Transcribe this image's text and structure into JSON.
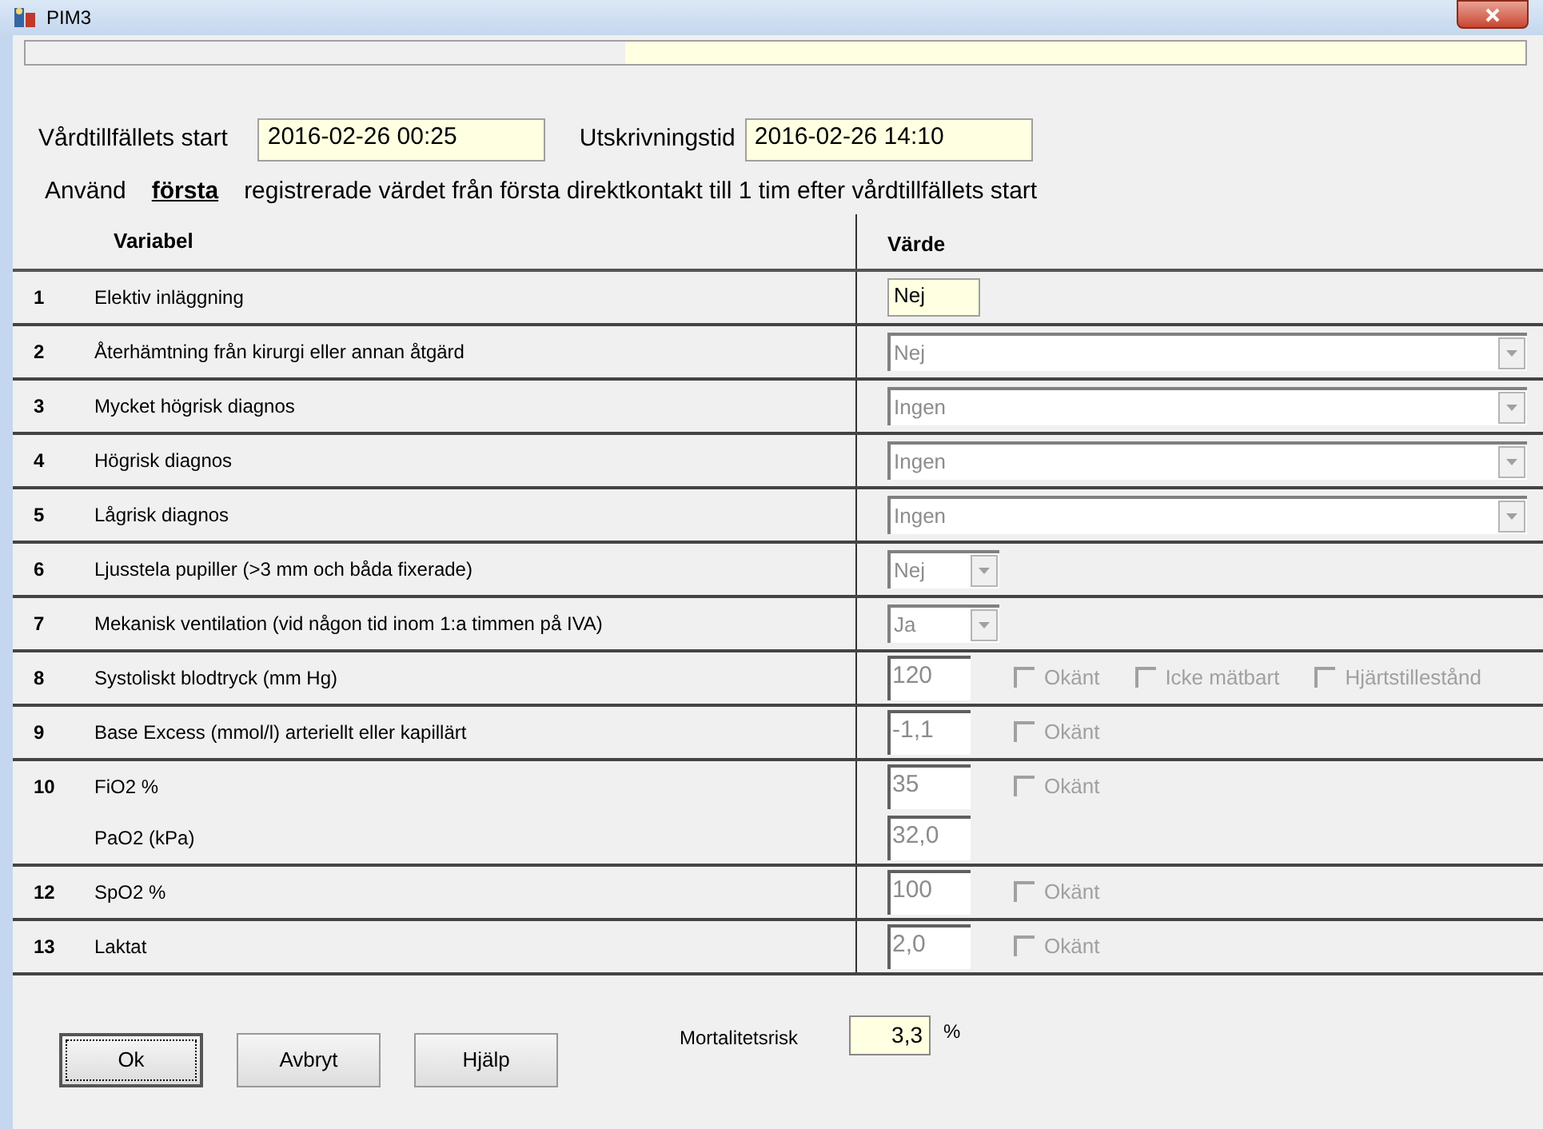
{
  "window": {
    "title": "PIM3"
  },
  "start": {
    "label": "Vårdtillfällets start",
    "value": "2016-02-26 00:25"
  },
  "discharge": {
    "label": "Utskrivningstid",
    "value": "2016-02-26 14:10"
  },
  "instruction": {
    "before": "Använd",
    "emphasis": "första",
    "after": "registrerade värdet från första direktkontakt till 1 tim efter vårdtillfällets start"
  },
  "table": {
    "columns": [
      "Variabel",
      "Värde"
    ],
    "rows": [
      {
        "number": "1",
        "lines": [
          {
            "label": "Elektiv inläggning",
            "kind": "entry",
            "value": "Nej",
            "disabled": false
          }
        ]
      },
      {
        "number": "2",
        "lines": [
          {
            "label": "Återhämtning från kirurgi eller annan åtgärd",
            "kind": "wide_combo",
            "value": "Nej",
            "disabled": true
          }
        ]
      },
      {
        "number": "3",
        "lines": [
          {
            "label": "Mycket högrisk diagnos",
            "kind": "wide_combo",
            "value": "Ingen",
            "disabled": true
          }
        ]
      },
      {
        "number": "4",
        "lines": [
          {
            "label": "Högrisk diagnos",
            "kind": "wide_combo",
            "value": "Ingen",
            "disabled": true
          }
        ]
      },
      {
        "number": "5",
        "lines": [
          {
            "label": "Lågrisk diagnos",
            "kind": "wide_combo",
            "value": "Ingen",
            "disabled": true
          }
        ]
      },
      {
        "number": "6",
        "lines": [
          {
            "label": "Ljusstela pupiller (>3 mm och båda fixerade)",
            "kind": "small_combo",
            "value": "Nej",
            "disabled": true
          }
        ]
      },
      {
        "number": "7",
        "lines": [
          {
            "label": "Mekanisk ventilation (vid någon tid inom 1:a timmen på IVA)",
            "kind": "small_combo",
            "value": "Ja",
            "disabled": true
          }
        ]
      },
      {
        "number": "8",
        "lines": [
          {
            "label": "Systoliskt blodtryck (mm Hg)",
            "kind": "number",
            "value": "120",
            "disabled": true,
            "checkboxes": [
              {
                "label": "Okänt",
                "checked": false
              },
              {
                "label": "Icke mätbart",
                "checked": false
              },
              {
                "label": "Hjärtstillestånd",
                "checked": false
              }
            ]
          }
        ]
      },
      {
        "number": "9",
        "lines": [
          {
            "label": "Base Excess (mmol/l) arteriellt eller kapillärt",
            "kind": "number",
            "value": "-1,1",
            "disabled": true,
            "checkboxes": [
              {
                "label": "Okänt",
                "checked": false
              }
            ]
          }
        ]
      },
      {
        "number": "10",
        "lines": [
          {
            "label": "FiO2 %",
            "kind": "number",
            "value": "35",
            "disabled": true,
            "checkboxes": [
              {
                "label": "Okänt",
                "checked": false
              }
            ]
          },
          {
            "label": "PaO2 (kPa)",
            "kind": "number",
            "value": "32,0",
            "disabled": true
          }
        ]
      },
      {
        "number": "12",
        "lines": [
          {
            "label": "SpO2 %",
            "kind": "number",
            "value": "100",
            "disabled": true,
            "checkboxes": [
              {
                "label": "Okänt",
                "checked": false
              }
            ]
          }
        ]
      },
      {
        "number": "13",
        "lines": [
          {
            "label": "Laktat",
            "kind": "number",
            "value": "2,0",
            "disabled": true,
            "checkboxes": [
              {
                "label": "Okänt",
                "checked": false
              }
            ]
          }
        ]
      }
    ]
  },
  "buttons": [
    {
      "label": "Ok",
      "focused": true
    },
    {
      "label": "Avbryt",
      "focused": false
    },
    {
      "label": "Hjälp",
      "focused": false
    }
  ],
  "mortality": {
    "label": "Mortalitetsrisk",
    "value": "3,3",
    "unit": "%"
  }
}
